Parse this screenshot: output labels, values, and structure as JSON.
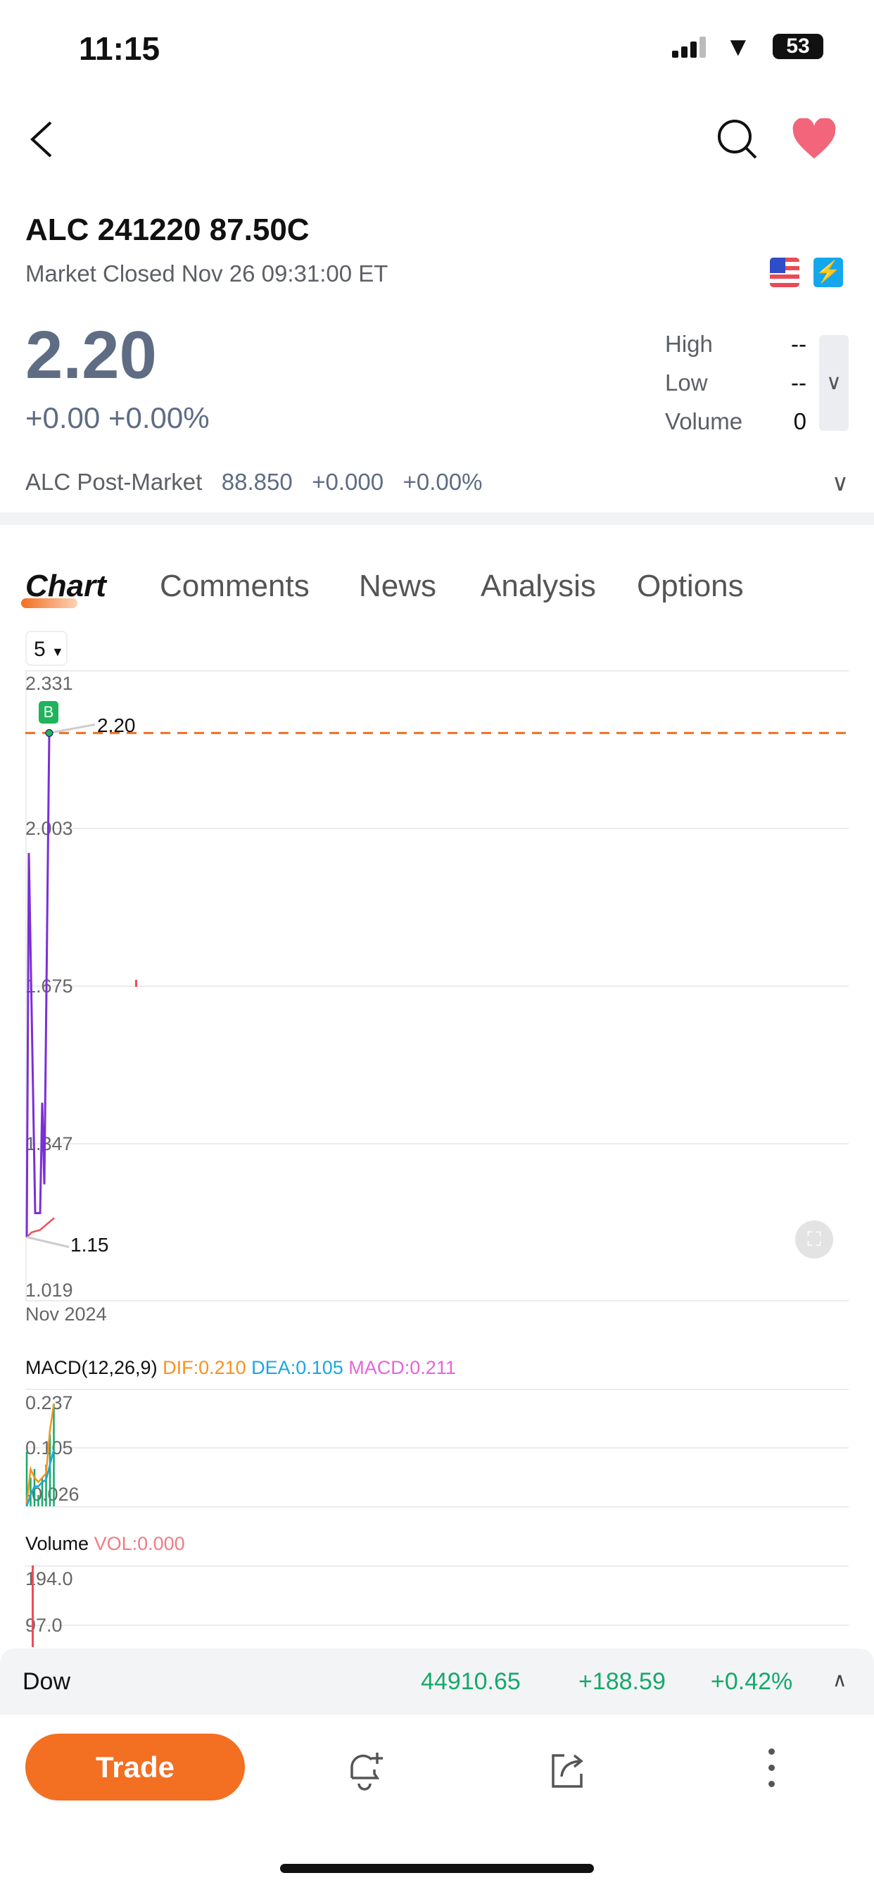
{
  "status_bar": {
    "time": "11:15",
    "battery": "53"
  },
  "header": {
    "title": "ALC 241220 87.50C",
    "market_status": "Market Closed Nov 26 09:31:00 ET"
  },
  "quote": {
    "price": "2.20",
    "change": "+0.00",
    "change_pct": "+0.00%",
    "stats": [
      {
        "label": "High",
        "value": "--"
      },
      {
        "label": "Low",
        "value": "--"
      },
      {
        "label": "Volume",
        "value": "0"
      }
    ]
  },
  "post_market": {
    "label": "ALC Post-Market",
    "price": "88.850",
    "change": "+0.000",
    "change_pct": "+0.00%"
  },
  "tabs": [
    {
      "label": "Chart",
      "active": true
    },
    {
      "label": "Comments"
    },
    {
      "label": "News"
    },
    {
      "label": "Analysis"
    },
    {
      "label": "Options"
    }
  ],
  "chart": {
    "period": "5",
    "date_label": "Nov 2024",
    "price_marker": "B",
    "last_label": "2.20",
    "low_label": "1.15"
  },
  "chart_data": [
    {
      "type": "line",
      "ylim": [
        1.019,
        2.331
      ],
      "yticks": [
        "2.331",
        "2.003",
        "1.675",
        "1.347",
        "1.019"
      ],
      "reference_line": 2.2,
      "series": [
        {
          "color": "#7b2fd6",
          "values": [
            1.15,
            1.95,
            1.2,
            1.2,
            1.43,
            1.26,
            2.07,
            2.2
          ]
        },
        {
          "color": "#f04b5a",
          "values": [
            1.15,
            1.16,
            1.165,
            1.19
          ]
        }
      ]
    },
    {
      "type": "line",
      "title": "MACD(12,26,9)",
      "legend": [
        {
          "text": "DIF:0.210",
          "color": "#f7931e"
        },
        {
          "text": "DEA:0.105",
          "color": "#1aa7e0"
        },
        {
          "text": "MACD:0.211",
          "color": "#e664d8"
        }
      ],
      "yticks": [
        "0.237",
        "0.105",
        "-0.026"
      ],
      "ylim": [
        -0.026,
        0.237
      ],
      "dif": [
        -0.02,
        0.06,
        0.04,
        0.03,
        0.04,
        0.05,
        0.15,
        0.21
      ],
      "dea": [
        -0.026,
        0.0,
        0.02,
        0.02,
        0.03,
        0.035,
        0.07,
        0.105
      ],
      "hist": [
        0.1,
        0.04,
        0.06,
        0.0,
        0.04,
        0.07,
        0.14,
        0.211
      ]
    },
    {
      "type": "bar",
      "title": "Volume",
      "legend": [
        {
          "text": "VOL:0.000",
          "color": "#f07b84"
        }
      ],
      "yticks": [
        "194.0",
        "97.0"
      ],
      "values": [
        194
      ]
    }
  ],
  "ticker_bar": {
    "name": "Dow",
    "value": "44910.65",
    "change": "+188.59",
    "change_pct": "+0.42%",
    "color": "#17a86b"
  },
  "bottom": {
    "trade_label": "Trade",
    "accent": "#f36f21"
  }
}
